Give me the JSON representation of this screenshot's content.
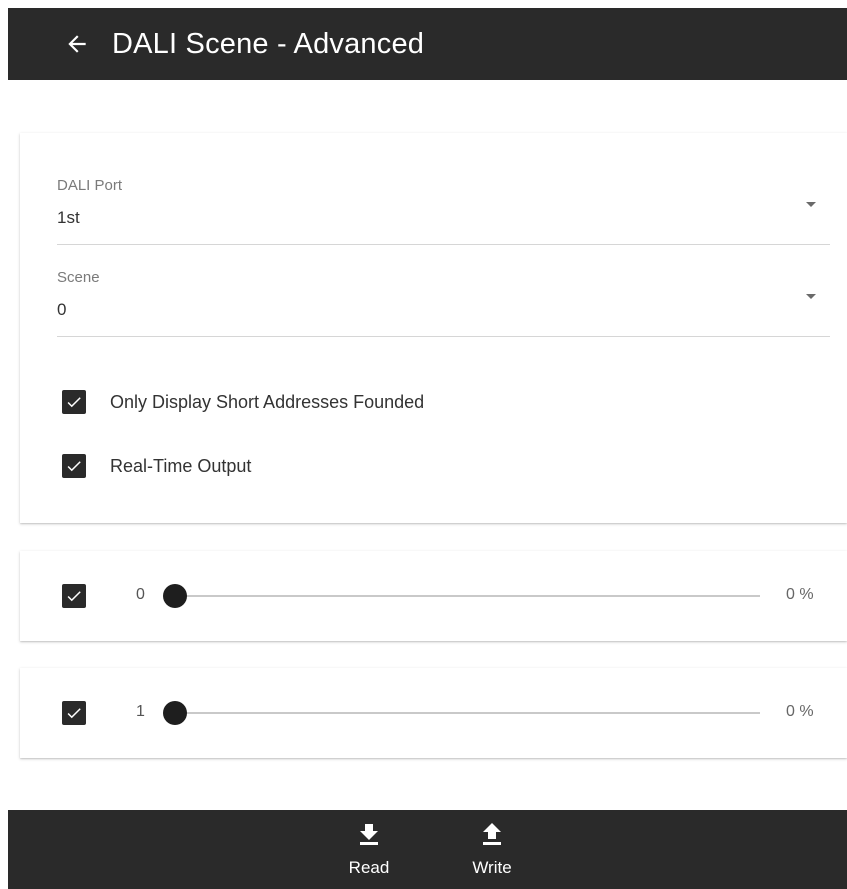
{
  "header": {
    "back_icon": "arrow-left-icon",
    "title": "DALI Scene - Advanced"
  },
  "settings": {
    "dali_port": {
      "label": "DALI Port",
      "value": "1st"
    },
    "scene": {
      "label": "Scene",
      "value": "0"
    },
    "options": [
      {
        "label": "Only Display Short Addresses Founded",
        "checked": true
      },
      {
        "label": "Real-Time Output",
        "checked": true
      }
    ]
  },
  "channels": [
    {
      "address": "0",
      "checked": true,
      "level": 0,
      "percent_text": "0 %"
    },
    {
      "address": "1",
      "checked": true,
      "level": 0,
      "percent_text": "0 %"
    }
  ],
  "footer": {
    "read": {
      "label": "Read",
      "icon": "download-icon"
    },
    "write": {
      "label": "Write",
      "icon": "upload-icon"
    }
  },
  "colors": {
    "bar": "#2a2a2a",
    "checkbox": "#2a2a2a",
    "slider_thumb": "#1e1e1e"
  }
}
